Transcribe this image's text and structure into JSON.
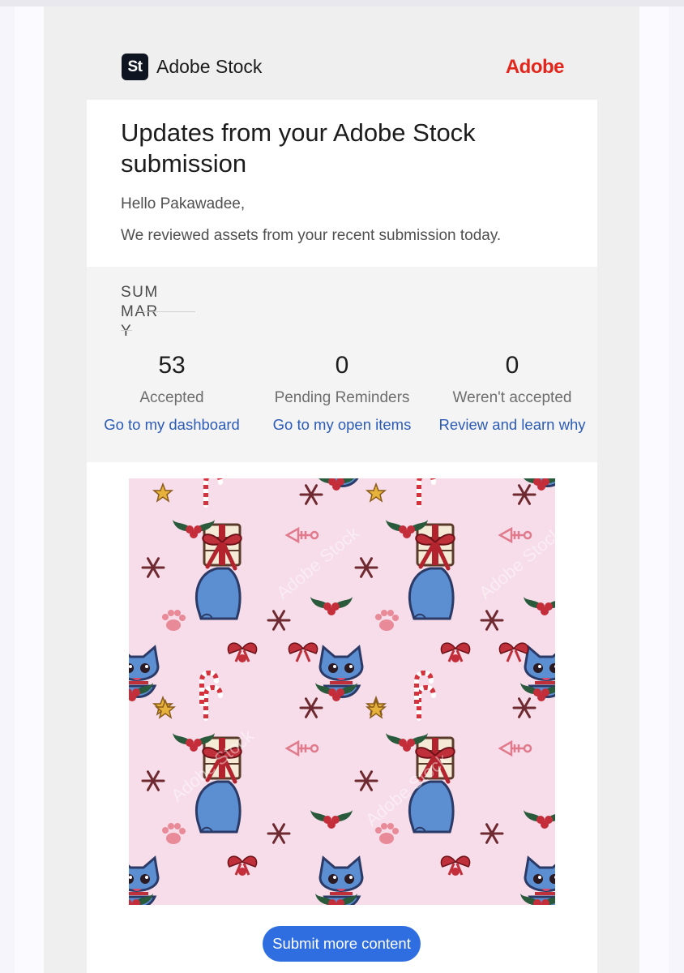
{
  "brand": {
    "logo_text": "St",
    "name": "Adobe Stock",
    "company": "Adobe"
  },
  "email": {
    "title": "Updates from your Adobe Stock submission",
    "greeting": "Hello Pakawadee,",
    "intro": "We reviewed assets from your recent submission today."
  },
  "summary": {
    "heading": "SUMMARY",
    "stats": [
      {
        "value": "53",
        "label": "Accepted",
        "link": "Go to my dashboard"
      },
      {
        "value": "0",
        "label": "Pending Reminders",
        "link": "Go to my open items"
      },
      {
        "value": "0",
        "label": "Weren't accepted",
        "link": "Review and learn why"
      }
    ]
  },
  "asset": {
    "watermark": "Adobe Stock",
    "description": "Christmas blue cat seamless pattern"
  },
  "cta": {
    "label": "Submit more content"
  },
  "colors": {
    "accent": "#2e6ee0",
    "link": "#2c5bb7",
    "adobe_red": "#e2261c",
    "pattern_bg": "#f6dde9"
  }
}
